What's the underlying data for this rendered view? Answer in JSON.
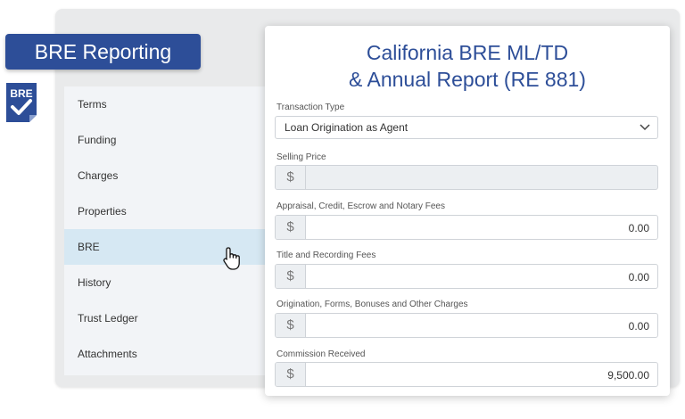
{
  "badge": {
    "title": "BRE Reporting"
  },
  "logo": {
    "text": "BRE",
    "icon": "checkmark-icon"
  },
  "sidebar": {
    "items": [
      {
        "label": "Terms"
      },
      {
        "label": "Funding"
      },
      {
        "label": "Charges"
      },
      {
        "label": "Properties"
      },
      {
        "label": "BRE",
        "active": true
      },
      {
        "label": "History"
      },
      {
        "label": "Trust Ledger"
      },
      {
        "label": "Attachments"
      }
    ]
  },
  "form": {
    "title_line1": "California BRE ML/TD",
    "title_line2": "& Annual Report (RE 881)",
    "transaction_type": {
      "label": "Transaction Type",
      "value": "Loan Origination as Agent"
    },
    "currency_symbol": "$",
    "fields": [
      {
        "label": "Selling Price",
        "value": "",
        "disabled": true
      },
      {
        "label": "Appraisal, Credit, Escrow and Notary Fees",
        "value": "0.00"
      },
      {
        "label": "Title and Recording Fees",
        "value": "0.00"
      },
      {
        "label": "Origination, Forms, Bonuses and Other Charges",
        "value": "0.00"
      },
      {
        "label": "Commission Received",
        "value": "9,500.00"
      }
    ]
  },
  "colors": {
    "brand": "#2d4e98",
    "active_row": "#d6e8f3",
    "backdrop": "#e9eaeb"
  }
}
